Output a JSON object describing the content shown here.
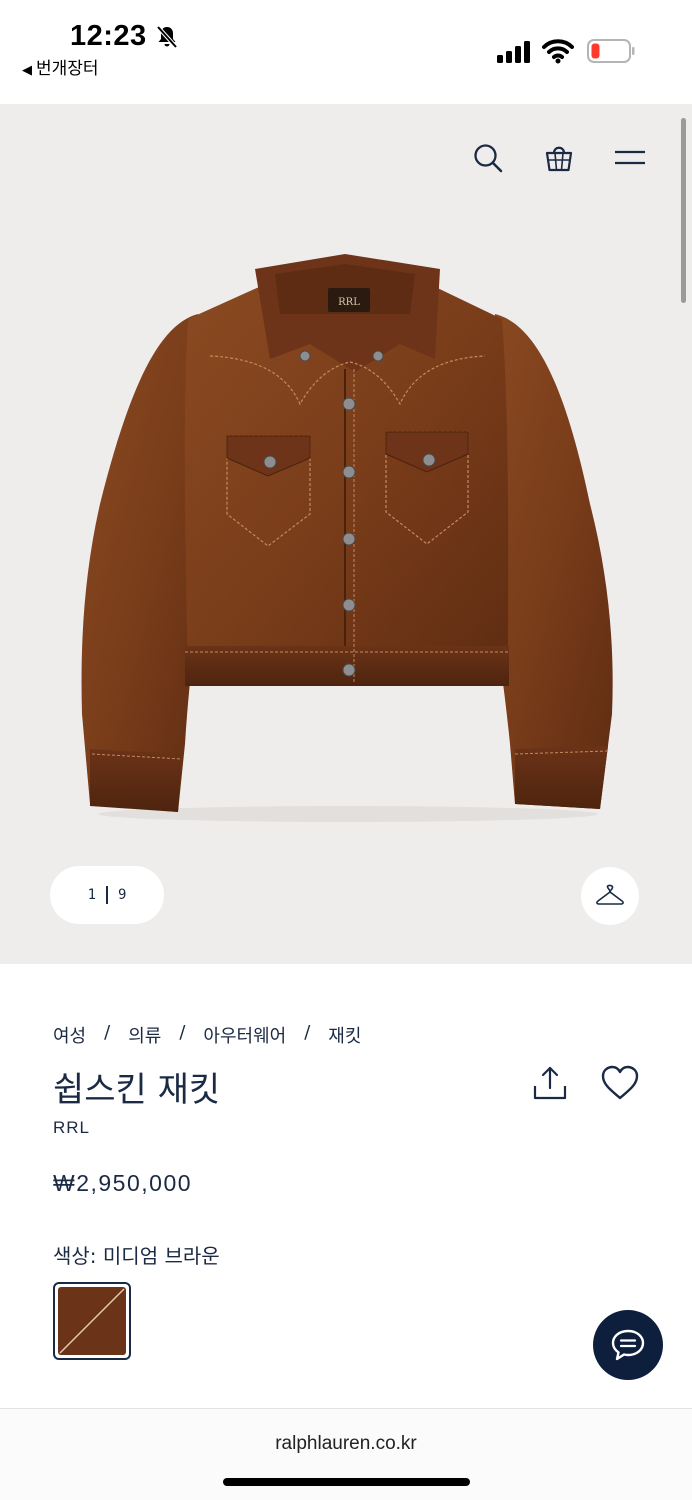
{
  "status": {
    "time": "12:23",
    "back_app": "번개장터"
  },
  "hero": {
    "pager_current": "1",
    "pager_total": "9"
  },
  "breadcrumb": [
    "여성",
    "의류",
    "아우터웨어",
    "재킷"
  ],
  "product": {
    "title": "쉽스킨 재킷",
    "brand": "RRL",
    "price": "₩2,950,000",
    "color_label": "색상: 미디엄 브라운",
    "swatch_color": "#6b3318"
  },
  "browser": {
    "url": "ralphlauren.co.kr"
  },
  "colors": {
    "navy": "#1b2a44",
    "hero_bg": "#efedec",
    "chat_bg": "#0d1f3c"
  }
}
